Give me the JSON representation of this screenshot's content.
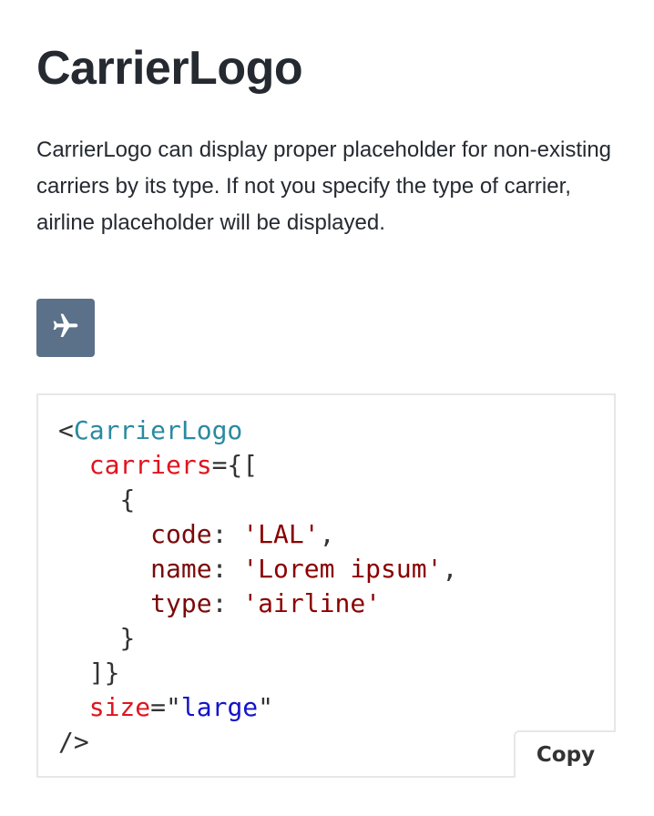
{
  "page": {
    "title": "CarrierLogo",
    "description": "CarrierLogo can display proper placeholder for non-existing carriers by its type. If not you specify the type of carrier, airline placeholder will be displayed."
  },
  "logo": {
    "icon": "airplane-icon",
    "background_color": "#5b7089"
  },
  "code": {
    "open": "<",
    "component": "CarrierLogo",
    "carriers_attr": "carriers",
    "carriers_open": "={[",
    "obj_open": "{",
    "code_key": "code",
    "code_value": "'LAL'",
    "name_key": "name",
    "name_value": "'Lorem ipsum'",
    "type_key": "type",
    "type_value": "'airline'",
    "obj_close": "}",
    "carriers_close": "]}",
    "size_attr": "size",
    "size_value": "large",
    "self_close": "/>"
  },
  "copy_button": {
    "label": "Copy"
  }
}
